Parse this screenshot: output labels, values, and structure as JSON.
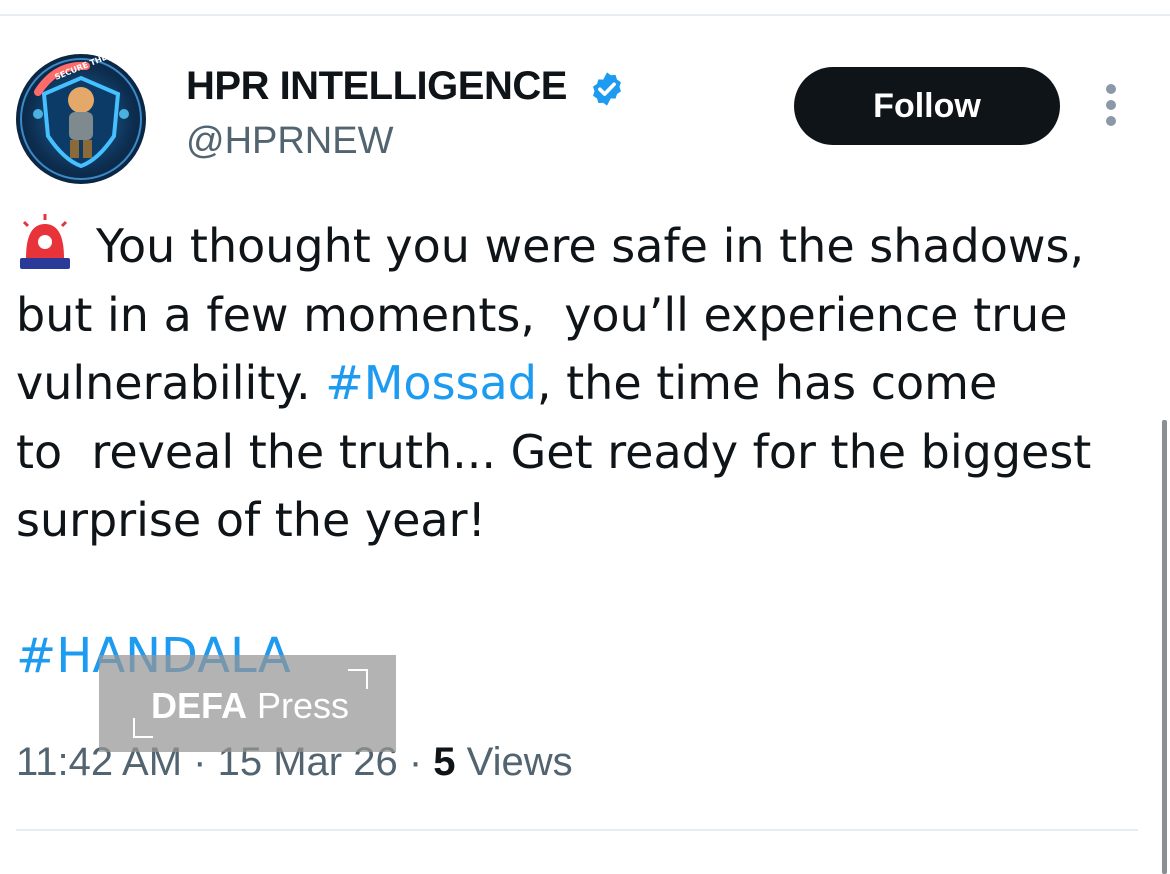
{
  "account": {
    "display_name": "HPR INTELLIGENCE",
    "handle": "@HPRNEW",
    "verified": true,
    "avatar_text": "SECURE THE WORLD"
  },
  "actions": {
    "follow_label": "Follow",
    "more_icon": "more-vertical-icon"
  },
  "tweet": {
    "emoji_icon": "rotating-light-icon",
    "lines": [
      "You thought you were safe in the shadows,",
      "but in a few moments,  you’ll experience true",
      "vulnerability. ",
      ", the time has come",
      "to  reveal the truth... Get ready for the biggest",
      "surprise of the year!"
    ],
    "mention_hashtag": "#Mossad",
    "bottom_hashtag": "#HANDALA"
  },
  "meta": {
    "time": "11:42 AM",
    "separator": " · ",
    "date": "15 Mar 26",
    "views_count": "5",
    "views_label": " Views"
  },
  "watermark": {
    "brand_bold": "DEFA",
    "brand_rest": " Press"
  },
  "colors": {
    "link": "#1d9bf0",
    "text": "#0f1419",
    "muted": "#536471",
    "button_bg": "#0f1419"
  }
}
